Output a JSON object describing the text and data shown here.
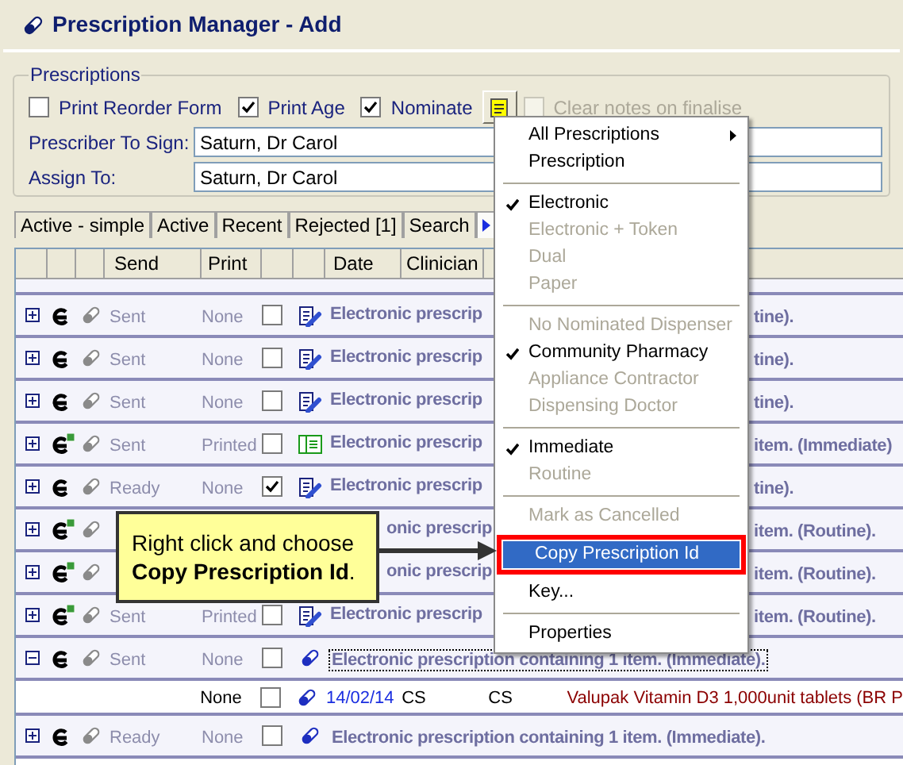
{
  "window": {
    "title": "Prescription Manager - Add"
  },
  "prescriptions": {
    "legend": "Prescriptions",
    "options": [
      {
        "kind": "checkbox",
        "label": "Print Reorder Form",
        "checked": false,
        "disabled": false
      },
      {
        "kind": "checkbox",
        "label": "Print Age",
        "checked": true,
        "disabled": false
      },
      {
        "kind": "checkbox",
        "label": "Nominate",
        "checked": true,
        "disabled": false
      },
      {
        "kind": "notes_button"
      },
      {
        "kind": "checkbox",
        "label": "Clear notes on finalise",
        "checked": false,
        "disabled": true
      }
    ],
    "fields": [
      {
        "label": "Prescriber To Sign:",
        "value": "Saturn, Dr Carol"
      },
      {
        "label": "Assign To:",
        "value": "Saturn, Dr Carol"
      }
    ]
  },
  "tabs": [
    {
      "label": "Active - simple",
      "selected": false
    },
    {
      "label": "Active",
      "selected": false
    },
    {
      "label": "Recent",
      "selected": false
    },
    {
      "label": "Rejected [1]",
      "selected": false
    },
    {
      "label": "Search",
      "selected": false
    },
    {
      "kind": "icon",
      "selected": true
    }
  ],
  "grid": {
    "header": {
      "send": "Send",
      "print": "Print",
      "date": "Date",
      "clinician": "Clinician"
    },
    "rows": [
      {
        "kind": "clipboard",
        "expanded": false,
        "focused": false,
        "printed_badge": false,
        "send": "Sent",
        "print": "None",
        "checked": false,
        "description_left": "Electronic prescrip",
        "description_right": "tine)."
      },
      {
        "kind": "clipboard",
        "expanded": false,
        "focused": false,
        "printed_badge": false,
        "send": "Sent",
        "print": "None",
        "checked": false,
        "description_left": "Electronic prescrip",
        "description_right": "tine)."
      },
      {
        "kind": "clipboard",
        "expanded": false,
        "focused": false,
        "printed_badge": false,
        "send": "Sent",
        "print": "None",
        "checked": false,
        "description_left": "Electronic prescrip",
        "description_right": "tine)."
      },
      {
        "kind": "book",
        "expanded": false,
        "focused": false,
        "printed_badge": true,
        "send": "Sent",
        "print": "Printed",
        "checked": false,
        "description_left": "Electronic prescrip",
        "description_right": "item. (Immediate)"
      },
      {
        "kind": "clipboard",
        "expanded": false,
        "focused": false,
        "printed_badge": false,
        "send": "Ready",
        "print": "None",
        "checked": true,
        "description_left": "Electronic prescrip",
        "description_right": "tine)."
      },
      {
        "expanded": false,
        "focused": false,
        "printed_badge": true,
        "description_left": "onic prescrip",
        "description_right": "item. (Routine)."
      },
      {
        "expanded": false,
        "focused": false,
        "printed_badge": true,
        "description_left": "onic prescrip",
        "description_right": "item. (Routine)."
      },
      {
        "kind": "clipboard",
        "expanded": false,
        "focused": false,
        "printed_badge": true,
        "send": "Sent",
        "print": "Printed",
        "checked": false,
        "description_left": "Electronic prescrip",
        "description_right": "item. (Routine)."
      },
      {
        "kind": "pill",
        "expanded": true,
        "focused": true,
        "printed_badge": false,
        "send": "Sent",
        "print": "None",
        "checked": false,
        "description": "Electronic prescription containing 1 item. (Immediate).",
        "children": [
          {
            "print": "None",
            "checked": false,
            "date": "14/02/14",
            "clinician": "CS",
            "column_10": "CS",
            "item": "Valupak Vitamin D3 1,000unit tablets (BR P"
          }
        ]
      },
      {
        "kind": "pill",
        "expanded": false,
        "focused": false,
        "printed_badge": false,
        "send": "Ready",
        "print": "None",
        "checked": false,
        "description": "Electronic prescription containing 1 item. (Immediate)."
      }
    ]
  },
  "context_menu": {
    "items": [
      {
        "kind": "item",
        "label": "All Prescriptions",
        "checked": false,
        "disabled": false,
        "selected": false,
        "submenu": true,
        "outlined": false
      },
      {
        "kind": "item",
        "label": "Prescription",
        "checked": false,
        "disabled": false,
        "selected": false,
        "submenu": false,
        "outlined": false
      },
      {
        "kind": "separator"
      },
      {
        "kind": "item",
        "label": "Electronic",
        "checked": true,
        "disabled": false,
        "selected": false,
        "submenu": false,
        "outlined": false
      },
      {
        "kind": "item",
        "label": "Electronic + Token",
        "checked": false,
        "disabled": true,
        "selected": false,
        "submenu": false,
        "outlined": false
      },
      {
        "kind": "item",
        "label": "Dual",
        "checked": false,
        "disabled": true,
        "selected": false,
        "submenu": false,
        "outlined": false
      },
      {
        "kind": "item",
        "label": "Paper",
        "checked": false,
        "disabled": true,
        "selected": false,
        "submenu": false,
        "outlined": false
      },
      {
        "kind": "separator"
      },
      {
        "kind": "item",
        "label": "No Nominated Dispenser",
        "checked": false,
        "disabled": true,
        "selected": false,
        "submenu": false,
        "outlined": false
      },
      {
        "kind": "item",
        "label": "Community Pharmacy",
        "checked": true,
        "disabled": false,
        "selected": false,
        "submenu": false,
        "outlined": false
      },
      {
        "kind": "item",
        "label": "Appliance Contractor",
        "checked": false,
        "disabled": true,
        "selected": false,
        "submenu": false,
        "outlined": false
      },
      {
        "kind": "item",
        "label": "Dispensing Doctor",
        "checked": false,
        "disabled": true,
        "selected": false,
        "submenu": false,
        "outlined": false
      },
      {
        "kind": "separator"
      },
      {
        "kind": "item",
        "label": "Immediate",
        "checked": true,
        "disabled": false,
        "selected": false,
        "submenu": false,
        "outlined": false
      },
      {
        "kind": "item",
        "label": "Routine",
        "checked": false,
        "disabled": true,
        "selected": false,
        "submenu": false,
        "outlined": false
      },
      {
        "kind": "separator"
      },
      {
        "kind": "item",
        "label": "Mark as Cancelled",
        "checked": false,
        "disabled": true,
        "selected": false,
        "submenu": false,
        "outlined": false
      },
      {
        "kind": "item",
        "label": "Copy Prescription Id",
        "checked": false,
        "disabled": false,
        "selected": true,
        "submenu": false,
        "outlined": true
      },
      {
        "kind": "item",
        "label": "Key...",
        "checked": false,
        "disabled": false,
        "selected": false,
        "submenu": false,
        "outlined": false
      },
      {
        "kind": "separator"
      },
      {
        "kind": "item",
        "label": "Properties",
        "checked": false,
        "disabled": false,
        "selected": false,
        "submenu": false,
        "outlined": false
      }
    ]
  },
  "callout": {
    "text": "Right click and choose **Copy Prescription Id**."
  }
}
